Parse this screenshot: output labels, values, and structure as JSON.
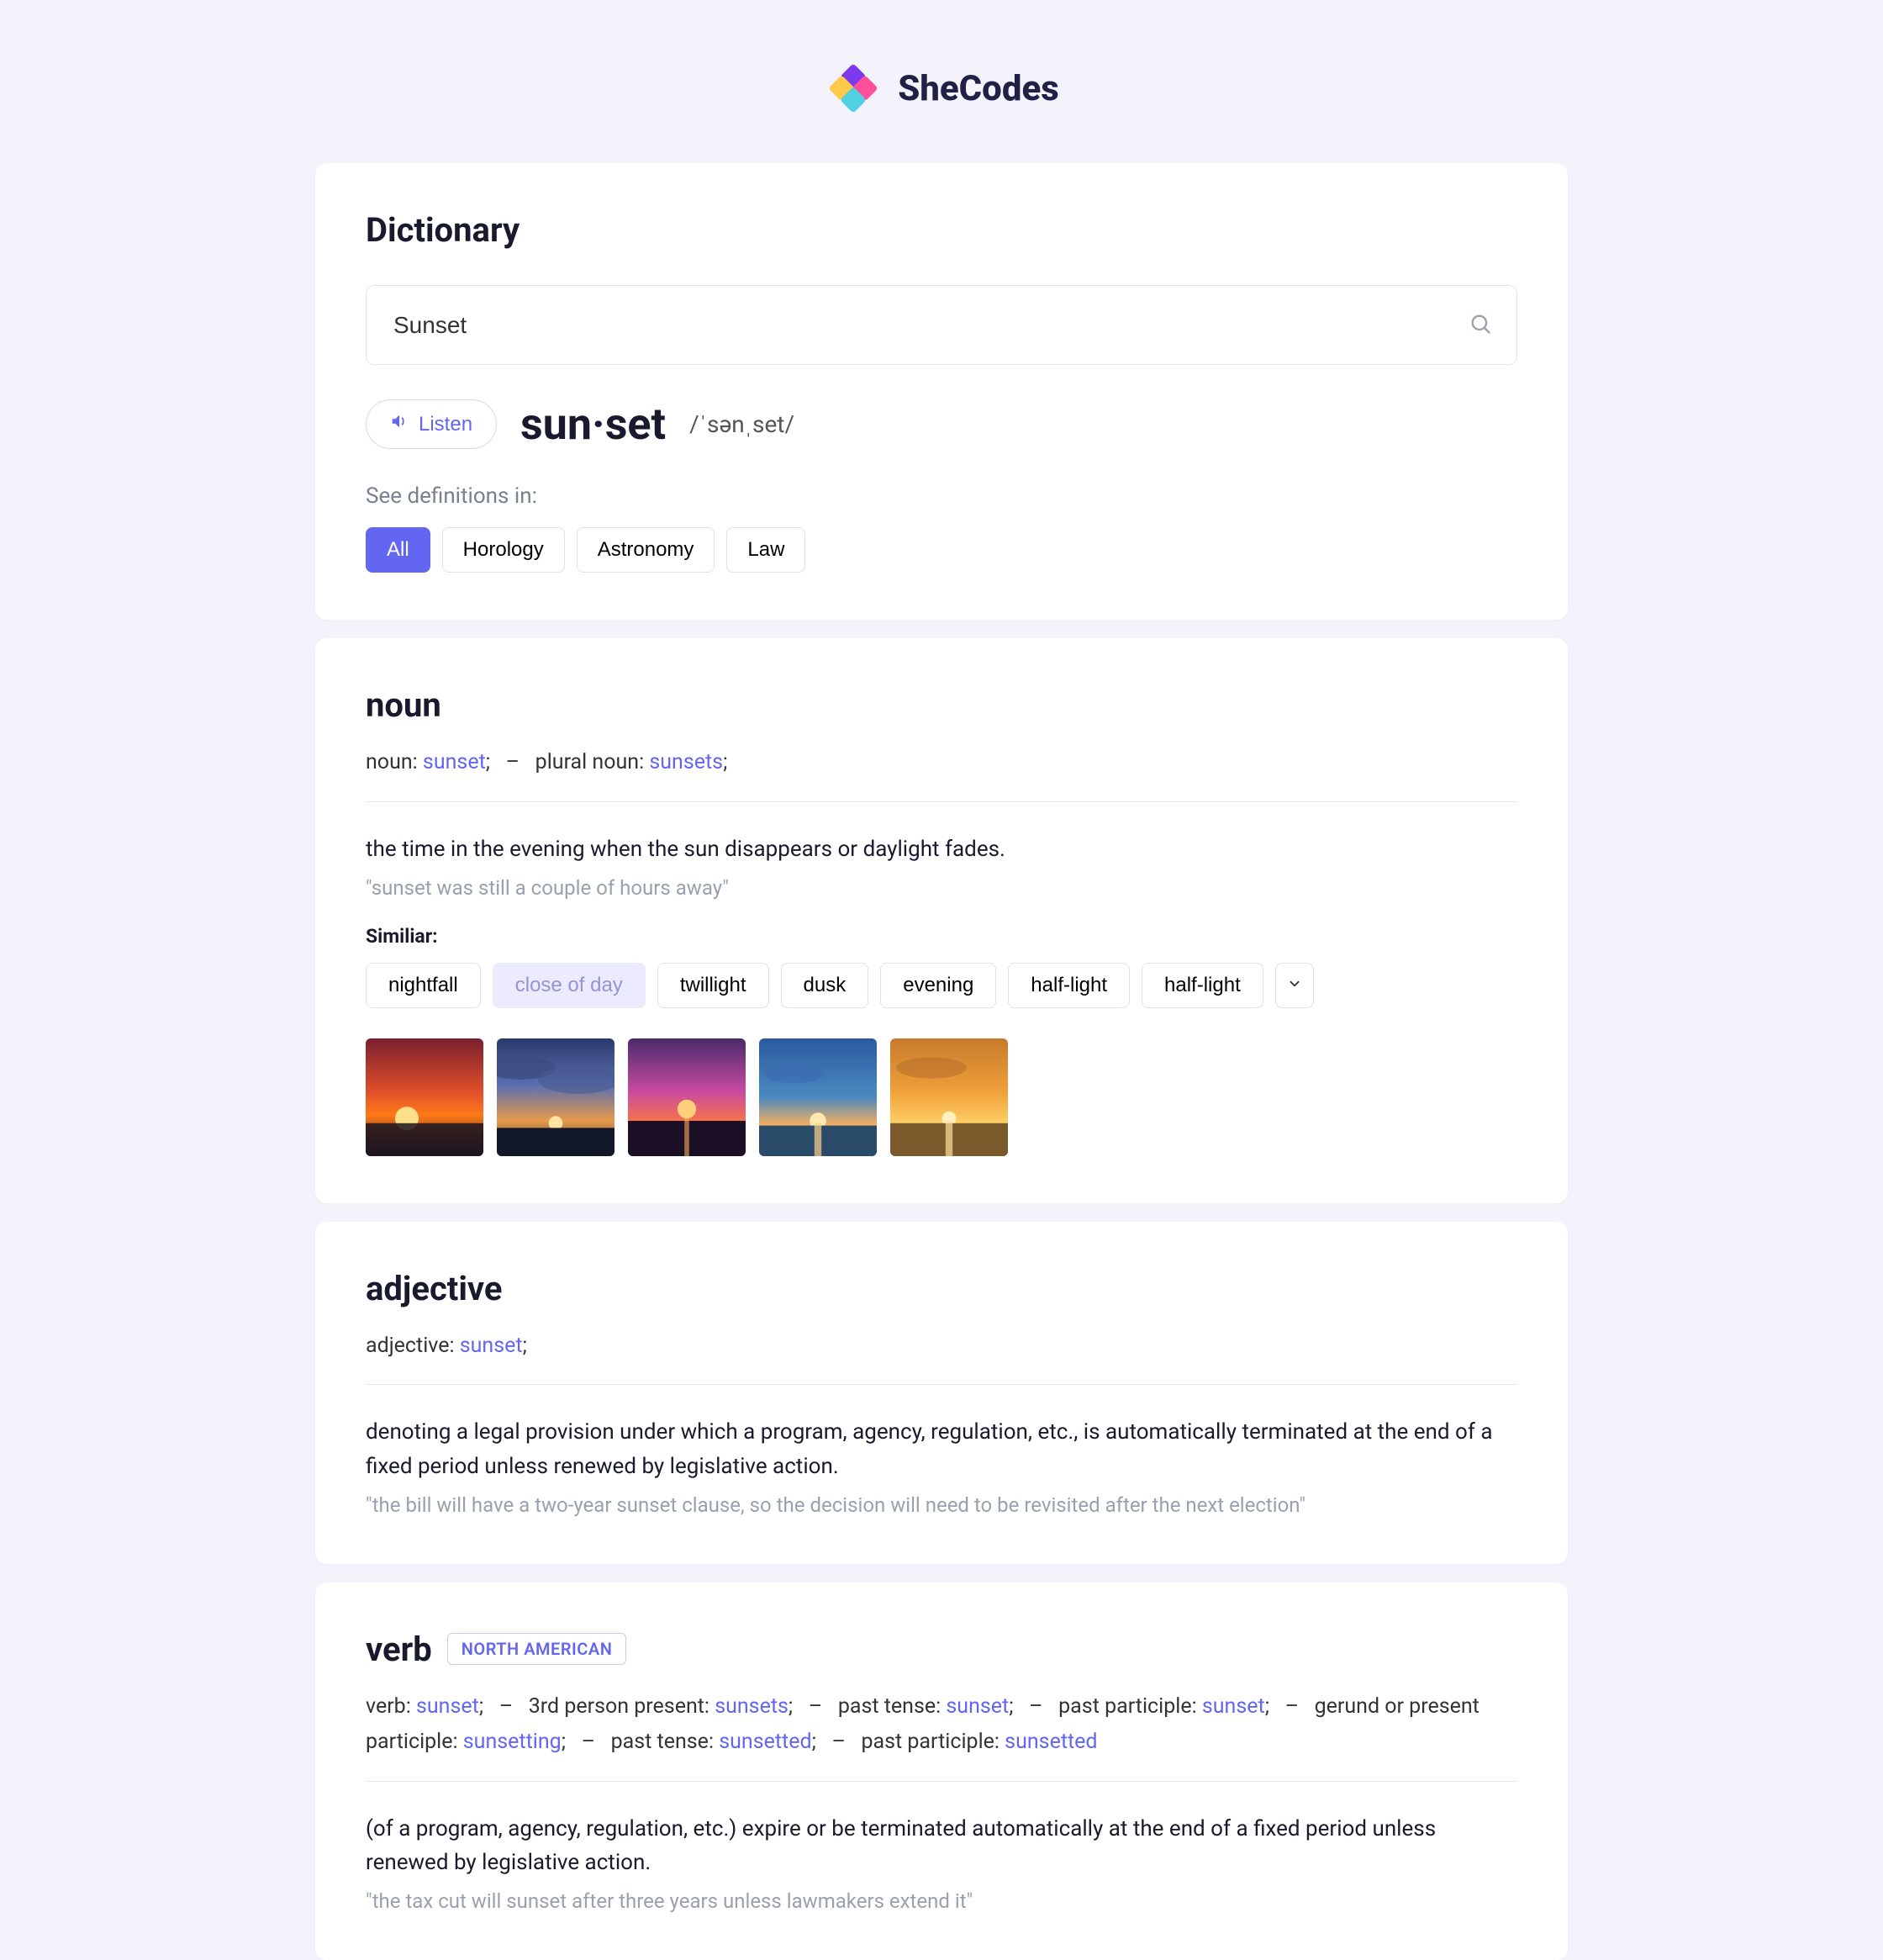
{
  "brand": {
    "name": "SheCodes"
  },
  "page": {
    "title": "Dictionary"
  },
  "search": {
    "value": "Sunset"
  },
  "listen": {
    "label": "Listen"
  },
  "word": {
    "syllabified": "sun·set",
    "phonetic": "/ˈsənˌset/"
  },
  "see_definitions": {
    "label": "See definitions in:",
    "categories": [
      "All",
      "Horology",
      "Astronomy",
      "Law"
    ],
    "active": 0
  },
  "entries": {
    "noun": {
      "heading": "noun",
      "forms_plain": "noun: sunset;   –   plural noun: sunsets;",
      "forms": [
        {
          "label": "noun",
          "value": "sunset"
        },
        {
          "label": "plural noun",
          "value": "sunsets"
        }
      ],
      "definition": "the time in the evening when the sun disappears or daylight fades.",
      "example": "\"sunset was still a couple of hours away\"",
      "similar_label": "Similiar:",
      "similar": [
        "nightfall",
        "close of day",
        "twillight",
        "dusk",
        "evening",
        "half-light",
        "half-light"
      ],
      "similar_muted_index": 1
    },
    "adjective": {
      "heading": "adjective",
      "forms_plain": "adjective: sunset;",
      "forms": [
        {
          "label": "adjective",
          "value": "sunset"
        }
      ],
      "definition": "denoting a legal provision under which a program, agency, regulation, etc., is automatically terminated at the end of a fixed period unless renewed by legislative action.",
      "example": "\"the bill will have a two-year sunset clause, so the decision will need to be revisited after the next election\""
    },
    "verb": {
      "heading": "verb",
      "region": "NORTH AMERICAN",
      "forms_plain": "verb: sunset;   –   3rd person present: sunsets;   –   past tense: sunset;   –   past participle: sunset;   –   gerund or present participle: sunsetting;   –   past tense: sunsetted;   –   past participle: sunsetted",
      "forms": [
        {
          "label": "verb",
          "value": "sunset"
        },
        {
          "label": "3rd person present",
          "value": "sunsets"
        },
        {
          "label": "past tense",
          "value": "sunset"
        },
        {
          "label": "past participle",
          "value": "sunset"
        },
        {
          "label": "gerund or present participle",
          "value": "sunsetting"
        },
        {
          "label": "past tense",
          "value": "sunsetted"
        },
        {
          "label": "past participle",
          "value": "sunsetted"
        }
      ],
      "definition": "(of a program, agency, regulation, etc.) expire or be terminated automatically at the end of a fixed period unless renewed by legislative action.",
      "example": "\"the tax cut will sunset after three years unless lawmakers extend it\""
    }
  }
}
